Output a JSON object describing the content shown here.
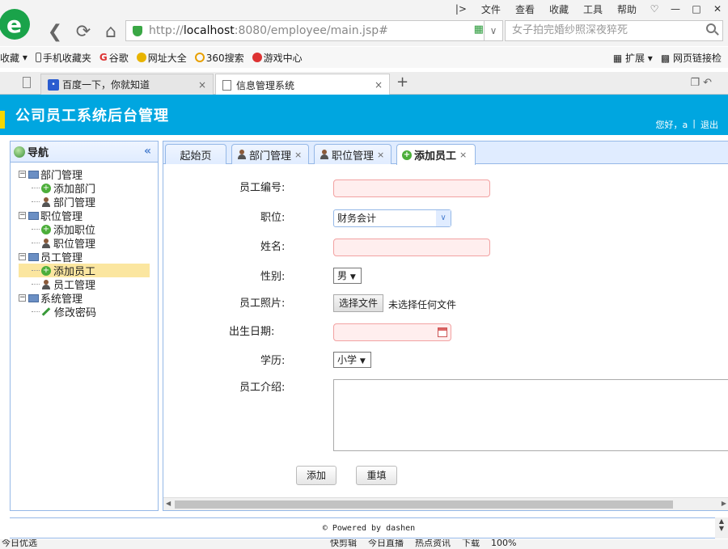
{
  "browser": {
    "menu": [
      "文件",
      "查看",
      "收藏",
      "工具",
      "帮助"
    ],
    "url_host": "http://",
    "url_domain": "localhost",
    "url_rest": ":8080/employee/main.jsp#",
    "search_placeholder": "女子拍完婚纱照深夜猝死",
    "bookmarks": [
      "收藏",
      "手机收藏夹",
      "谷歌",
      "网址大全",
      "360搜索",
      "游戏中心"
    ],
    "bookmarks_right": [
      "扩展",
      "网页链接检"
    ],
    "tabs": [
      {
        "label": "百度一下，你就知道"
      },
      {
        "label": "信息管理系统"
      }
    ],
    "new_tab": "+",
    "status_left": "今日优选",
    "status_right": [
      "快剪辑",
      "今日直播",
      "热点资讯",
      "下载",
      "100%"
    ]
  },
  "app": {
    "title": "公司员工系统后台管理",
    "greeting": "您好，",
    "user": "a",
    "sep": "|",
    "logout": "退出",
    "nav_title": "导航",
    "footer": "Powered by dashen"
  },
  "tree": {
    "dept": "部门管理",
    "dept_add": "添加部门",
    "dept_manage": "部门管理",
    "pos": "职位管理",
    "pos_add": "添加职位",
    "pos_manage": "职位管理",
    "emp": "员工管理",
    "emp_add": "添加员工",
    "emp_manage": "员工管理",
    "sys": "系统管理",
    "sys_pwd": "修改密码"
  },
  "tabs": {
    "home": "起始页",
    "dept": "部门管理",
    "pos": "职位管理",
    "add_emp": "添加员工",
    "close": "×"
  },
  "form": {
    "emp_no_label": "员工编号:",
    "position_label": "职位:",
    "position_value": "财务会计",
    "name_label": "姓名:",
    "gender_label": "性别:",
    "gender_value": "男",
    "photo_label": "员工照片:",
    "photo_button": "选择文件",
    "photo_status": "未选择任何文件",
    "birth_label": "出生日期:",
    "edu_label": "学历:",
    "edu_value": "小学",
    "intro_label": "员工介绍:",
    "submit": "添加",
    "reset": "重填"
  }
}
